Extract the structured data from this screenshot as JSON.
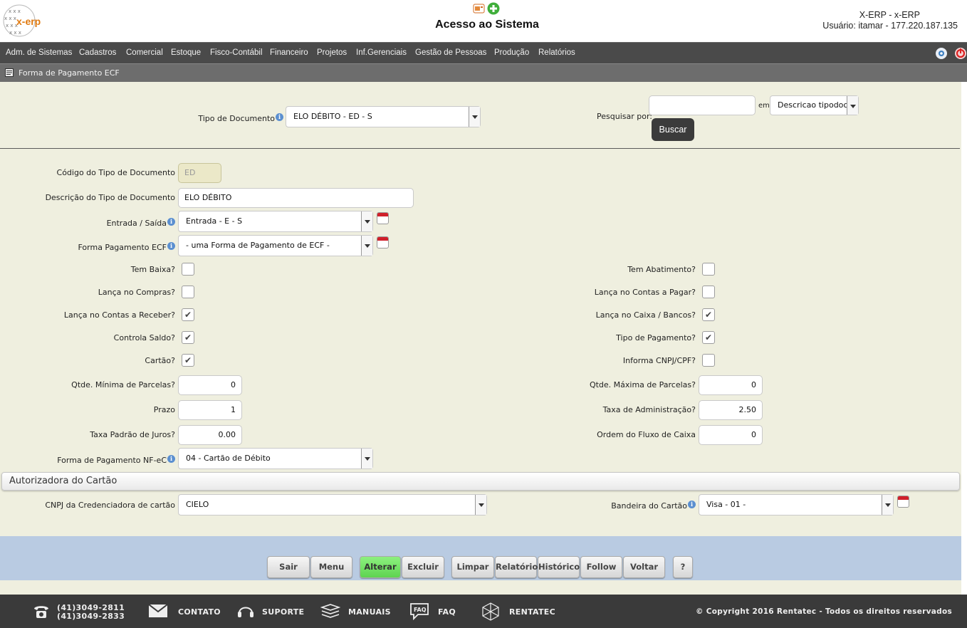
{
  "header": {
    "logo_text": "x-erp",
    "page_title": "Acesso ao Sistema",
    "system_name": "X-ERP - x-ERP",
    "user_line": "Usuário: itamar - 177.220.187.135"
  },
  "menubar": {
    "items": [
      "Adm. de Sistemas",
      "Cadastros",
      "Comercial",
      "Estoque",
      "Fisco-Contábil",
      "Financeiro",
      "Projetos",
      "Inf.Gerenciais",
      "Gestão de Pessoas",
      "Produção",
      "Relatórios"
    ]
  },
  "breadcrumb": {
    "text": "Forma de Pagamento ECF"
  },
  "search": {
    "tipo_documento_label": "Tipo de Documento",
    "tipo_documento_value": "ELO DÉBITO - ED - S",
    "pesquisar_label": "Pesquisar por:",
    "pesquisar_value": "",
    "em_label": "em",
    "campo_value": "Descricao tipodoc",
    "buscar_label": "Buscar"
  },
  "form": {
    "codigo_label": "Código do Tipo de Documento",
    "codigo_value": "ED",
    "descricao_label": "Descrição do Tipo de Documento",
    "descricao_value": "ELO DÉBITO",
    "entrada_saida_label": "Entrada / Saída",
    "entrada_saida_value": "Entrada - E - S",
    "forma_pagto_ecf_label": "Forma Pagamento ECF",
    "forma_pagto_ecf_value": "- uma Forma de Pagamento de ECF -",
    "checks_left": [
      {
        "label": "Tem Baixa?",
        "checked": false
      },
      {
        "label": "Lança no Compras?",
        "checked": false
      },
      {
        "label": "Lança no Contas a Receber?",
        "checked": true
      },
      {
        "label": "Controla Saldo?",
        "checked": true
      },
      {
        "label": "Cartão?",
        "checked": true
      }
    ],
    "checks_right": [
      {
        "label": "Tem Abatimento?",
        "checked": false
      },
      {
        "label": "Lança no Contas a Pagar?",
        "checked": false
      },
      {
        "label": "Lança no Caixa / Bancos?",
        "checked": true
      },
      {
        "label": "Tipo de Pagamento?",
        "checked": true
      },
      {
        "label": "Informa CNPJ/CPF?",
        "checked": false
      }
    ],
    "qtde_min_label": "Qtde. Mínima de Parcelas?",
    "qtde_min_value": "0",
    "qtde_max_label": "Qtde. Máxima de Parcelas?",
    "qtde_max_value": "0",
    "prazo_label": "Prazo",
    "prazo_value": "1",
    "taxa_adm_label": "Taxa de Administração?",
    "taxa_adm_value": "2.50",
    "taxa_juros_label": "Taxa Padrão de Juros?",
    "taxa_juros_value": "0.00",
    "ordem_fluxo_label": "Ordem do Fluxo de Caixa",
    "ordem_fluxo_value": "0",
    "forma_pagto_nfce_label": "Forma de Pagamento NF-eC",
    "forma_pagto_nfce_value": "04 - Cartão de Débito"
  },
  "card_section": {
    "title": "Autorizadora do Cartão",
    "cnpj_label": "CNPJ da Credenciadora de cartão",
    "cnpj_value": "CIELO",
    "bandeira_label": "Bandeira do Cartão",
    "bandeira_value": "Visa - 01 -"
  },
  "buttons": {
    "sair": "Sair",
    "menu": "Menu",
    "alterar": "Alterar",
    "excluir": "Excluir",
    "limpar": "Limpar",
    "relatorio": "Relatório",
    "historico": "Histórico",
    "follow_up": "Follow Up",
    "voltar": "Voltar",
    "help": "?"
  },
  "footer": {
    "phone1": "(41)3049-2811",
    "phone2": "(41)3049-2833",
    "contato": "CONTATO",
    "suporte": "SUPORTE",
    "manuais": "MANUAIS",
    "faq": "FAQ",
    "rentatec": "RENTATEC",
    "copyright": "© Copyright 2016 Rentatec - Todos os direitos reservados"
  },
  "colors": {
    "menubar": "#4a4a4a",
    "form_bg": "#efefdf",
    "button_bar": "#b9cbe2",
    "footer": "#3a3a3a",
    "alterar_green": "#5ed450"
  }
}
